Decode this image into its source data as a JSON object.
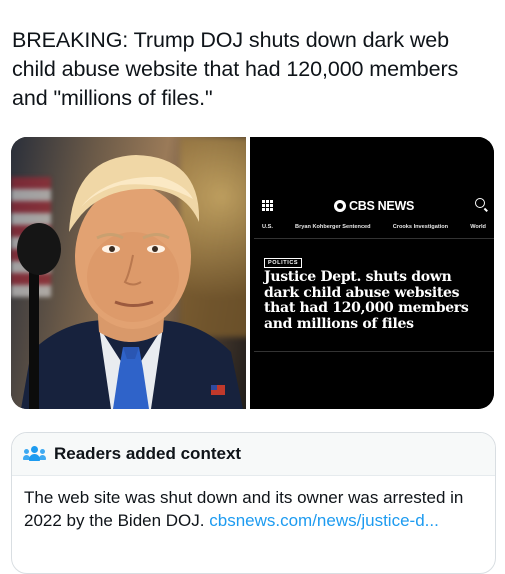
{
  "post": {
    "text": "BREAKING: Trump DOJ shuts down dark web child abuse website that had 120,000 members and \"millions of files.\""
  },
  "media": {
    "photo_alt_icon": "person-photo",
    "cbs": {
      "logo": "CBS NEWS",
      "nav": [
        "U.S.",
        "Bryan Kohberger Sentenced",
        "Crooks Investigation",
        "World"
      ],
      "badge": "POLITICS",
      "headline": "Justice Dept. shuts down dark child abuse websites that had 120,000 members and millions of files"
    }
  },
  "context": {
    "title": "Readers added context",
    "body": "The web site was shut down and its owner was arrested in 2022 by the Biden DOJ. ",
    "link": "cbsnews.com/news/justice-d..."
  },
  "colors": {
    "link": "#1d9bf0",
    "text": "#0f1419"
  }
}
